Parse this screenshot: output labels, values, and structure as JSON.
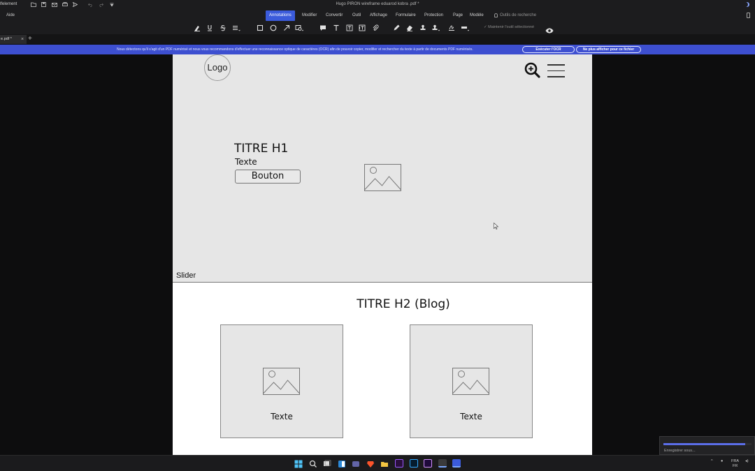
{
  "titlebar": {
    "app_name": "lfelement",
    "document_title": "Hugo PIRON wireframe eduarod kobra .pdf *"
  },
  "menubar": {
    "help": "Aide",
    "items": [
      "Annotations",
      "Modifier",
      "Convertir",
      "Outil",
      "Affichage",
      "Formulaire",
      "Protection",
      "Page",
      "Modèle"
    ],
    "active": "Annotations",
    "search_tools": "Outils de recherche"
  },
  "toolbar": {
    "keep_tool": "Maintenir l'outil sélectionné"
  },
  "tabs": {
    "active_tab": "e.pdf *",
    "close": "×",
    "add": "+"
  },
  "ocr_banner": {
    "message": "Nous détectons qu'il s'agit d'un PDF numérisé et nous vous recommandons d'effectuer une reconnaissance optique de caractères (OCR) afin de pouvoir copier, modifier et rechercher du texte à partir de documents PDF numérisés.",
    "run_ocr": "Exécuter l'OCR",
    "dont_show": "Ne plus afficher pour ce fichier"
  },
  "wireframe": {
    "logo": "Logo",
    "h1": "TITRE H1",
    "text": "Texte",
    "button": "Bouton",
    "slider": "Slider",
    "h2": "TITRE H2 (Blog)",
    "cards": [
      {
        "text": "Texte"
      },
      {
        "text": "Texte"
      }
    ]
  },
  "save_popup": {
    "label": "Enregistrer sous...",
    "progress": 0.93
  },
  "taskbar": {
    "lang": "FRA",
    "region": "FR"
  },
  "colors": {
    "accent": "#3b5bdb",
    "banner": "#3d4fd0",
    "wireframe_gray": "#e6e6e6"
  }
}
